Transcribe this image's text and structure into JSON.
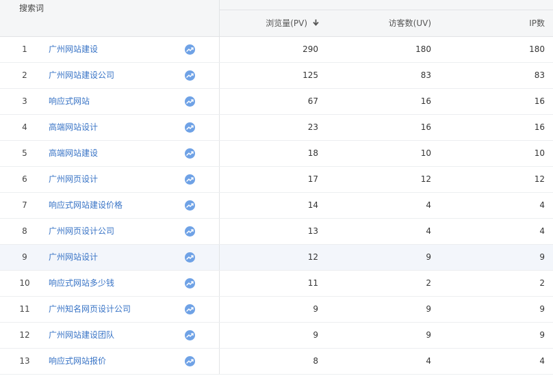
{
  "header": {
    "keyword_label": "搜索词",
    "pv_label": "浏览量(PV)",
    "uv_label": "访客数(UV)",
    "ip_label": "IP数",
    "sort_icon": "arrow-down-icon"
  },
  "colors": {
    "link": "#3974c6",
    "trend_icon": "#6fa2e6",
    "header_bg": "#f5f6f7",
    "highlight_row": "#f3f6fb"
  },
  "highlighted_row": 9,
  "rows": [
    {
      "index": "1",
      "keyword": "广州网站建设",
      "pv": "290",
      "uv": "180",
      "ip": "180"
    },
    {
      "index": "2",
      "keyword": "广州网站建设公司",
      "pv": "125",
      "uv": "83",
      "ip": "83"
    },
    {
      "index": "3",
      "keyword": "响应式网站",
      "pv": "67",
      "uv": "16",
      "ip": "16"
    },
    {
      "index": "4",
      "keyword": "高端网站设计",
      "pv": "23",
      "uv": "16",
      "ip": "16"
    },
    {
      "index": "5",
      "keyword": "高端网站建设",
      "pv": "18",
      "uv": "10",
      "ip": "10"
    },
    {
      "index": "6",
      "keyword": "广州网页设计",
      "pv": "17",
      "uv": "12",
      "ip": "12"
    },
    {
      "index": "7",
      "keyword": "响应式网站建设价格",
      "pv": "14",
      "uv": "4",
      "ip": "4"
    },
    {
      "index": "8",
      "keyword": "广州网页设计公司",
      "pv": "13",
      "uv": "4",
      "ip": "4"
    },
    {
      "index": "9",
      "keyword": "广州网站设计",
      "pv": "12",
      "uv": "9",
      "ip": "9"
    },
    {
      "index": "10",
      "keyword": "响应式网站多少钱",
      "pv": "11",
      "uv": "2",
      "ip": "2"
    },
    {
      "index": "11",
      "keyword": "广州知名网页设计公司",
      "pv": "9",
      "uv": "9",
      "ip": "9"
    },
    {
      "index": "12",
      "keyword": "广州网站建设团队",
      "pv": "9",
      "uv": "9",
      "ip": "9"
    },
    {
      "index": "13",
      "keyword": "响应式网站报价",
      "pv": "8",
      "uv": "4",
      "ip": "4"
    }
  ]
}
